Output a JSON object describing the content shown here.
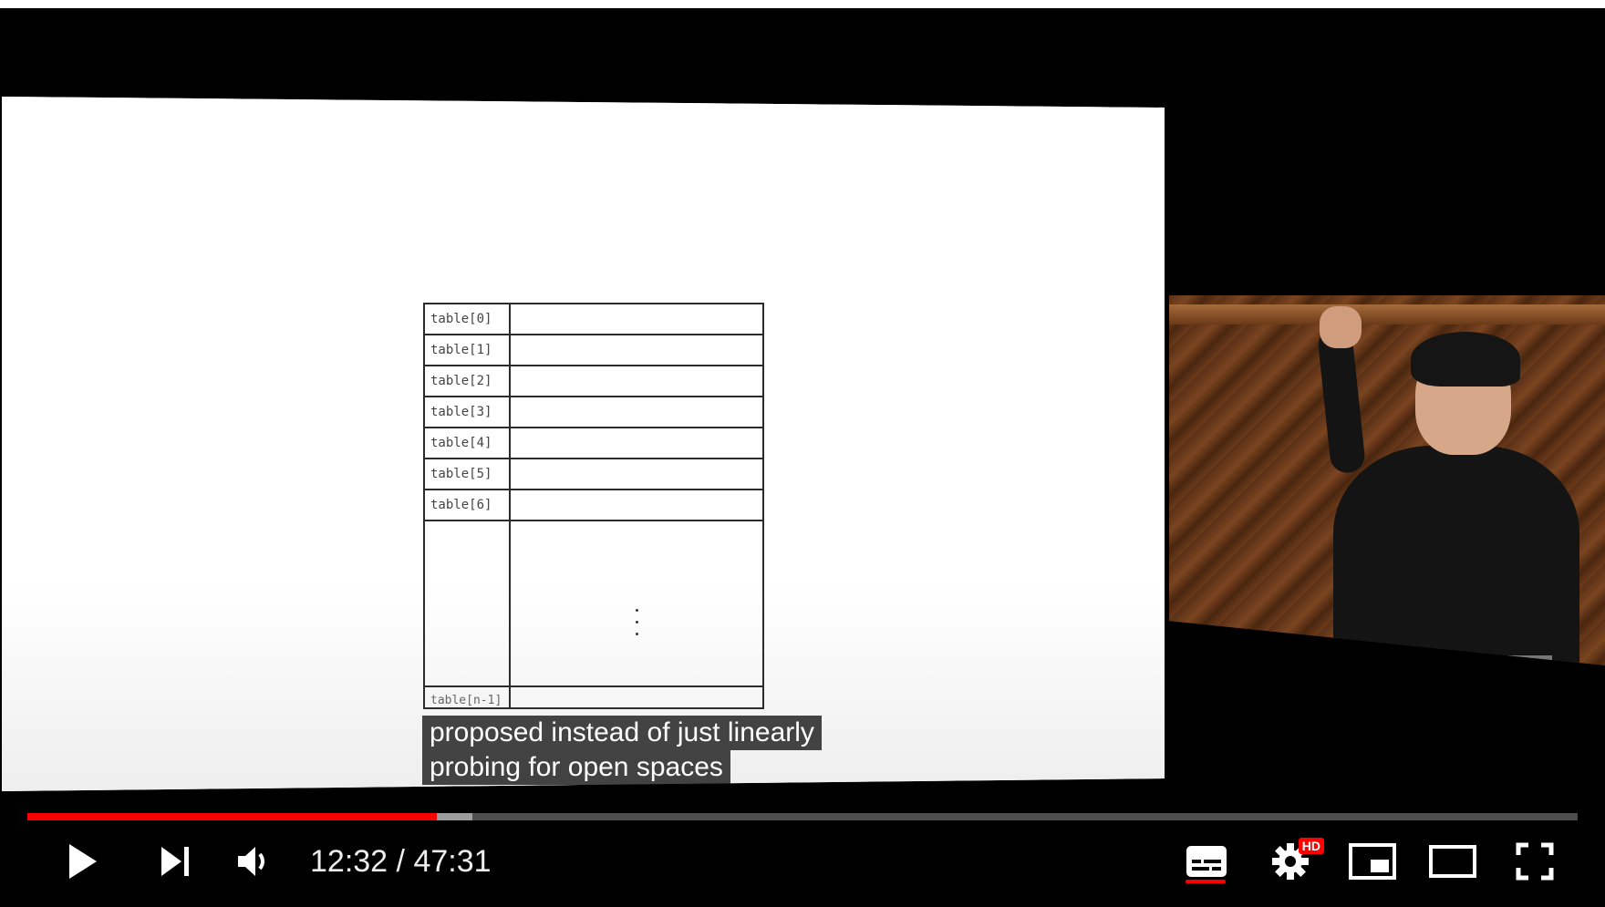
{
  "slide": {
    "rows": [
      "table[0]",
      "table[1]",
      "table[2]",
      "table[3]",
      "table[4]",
      "table[5]",
      "table[6]"
    ],
    "last_row": "table[n-1]"
  },
  "captions": {
    "line1": "proposed instead of just linearly",
    "line2": "probing for open spaces"
  },
  "player": {
    "current_time": "12:32",
    "separator": " / ",
    "duration": "47:31",
    "played_fraction": 0.264,
    "buffered_fraction": 0.287,
    "accent_color": "#ff0000",
    "hd_badge": "HD"
  },
  "controls": {
    "icons": [
      "play-icon",
      "next-icon",
      "volume-icon",
      "subtitles-icon",
      "settings-icon",
      "miniplayer-icon",
      "theater-mode-icon",
      "fullscreen-icon"
    ]
  }
}
